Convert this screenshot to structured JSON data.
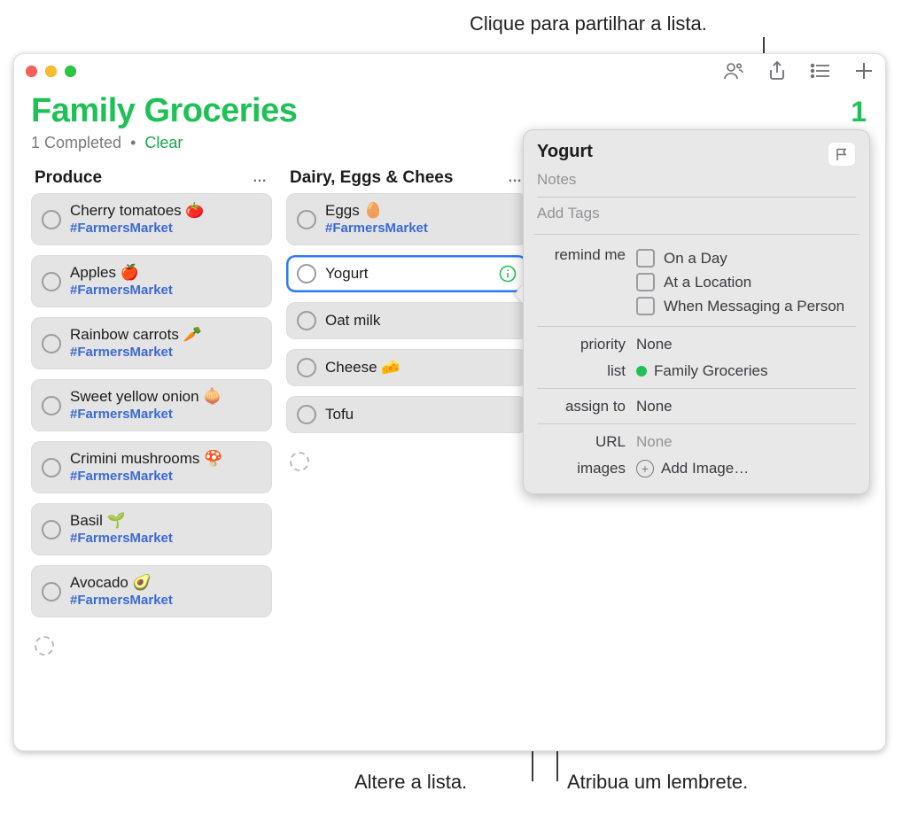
{
  "annotations": {
    "share": "Clique para partilhar a lista.",
    "change_list": "Altere a lista.",
    "assign": "Atribua um lembrete."
  },
  "toolbar_icons": [
    "collaborate-icon",
    "share-icon",
    "view-icon",
    "add-icon"
  ],
  "list": {
    "title": "Family Groceries",
    "completed_label": "1 Completed",
    "clear_label": "Clear",
    "count_peek": "1"
  },
  "columns": [
    {
      "title": "Produce",
      "items": [
        {
          "label": "Cherry tomatoes 🍅",
          "tag": "#FarmersMarket"
        },
        {
          "label": "Apples 🍎",
          "tag": "#FarmersMarket"
        },
        {
          "label": "Rainbow carrots 🥕",
          "tag": "#FarmersMarket"
        },
        {
          "label": "Sweet yellow onion 🧅",
          "tag": "#FarmersMarket"
        },
        {
          "label": "Crimini mushrooms 🍄",
          "tag": "#FarmersMarket"
        },
        {
          "label": "Basil 🌱",
          "tag": "#FarmersMarket"
        },
        {
          "label": "Avocado 🥑",
          "tag": "#FarmersMarket"
        }
      ]
    },
    {
      "title": "Dairy, Eggs & Chees",
      "items": [
        {
          "label": "Eggs 🥚",
          "tag": "#FarmersMarket"
        },
        {
          "label": "Yogurt",
          "selected": true
        },
        {
          "label": "Oat milk"
        },
        {
          "label": "Cheese 🧀"
        },
        {
          "label": "Tofu"
        }
      ]
    }
  ],
  "panel": {
    "title": "Yogurt",
    "notes_placeholder": "Notes",
    "tags_placeholder": "Add Tags",
    "remind_label": "remind me",
    "remind_options": [
      "On a Day",
      "At a Location",
      "When Messaging a Person"
    ],
    "priority_label": "priority",
    "priority_value": "None",
    "list_label": "list",
    "list_value": "Family Groceries",
    "assign_label": "assign to",
    "assign_value": "None",
    "url_label": "URL",
    "url_value": "None",
    "images_label": "images",
    "add_image_label": "Add Image…"
  }
}
